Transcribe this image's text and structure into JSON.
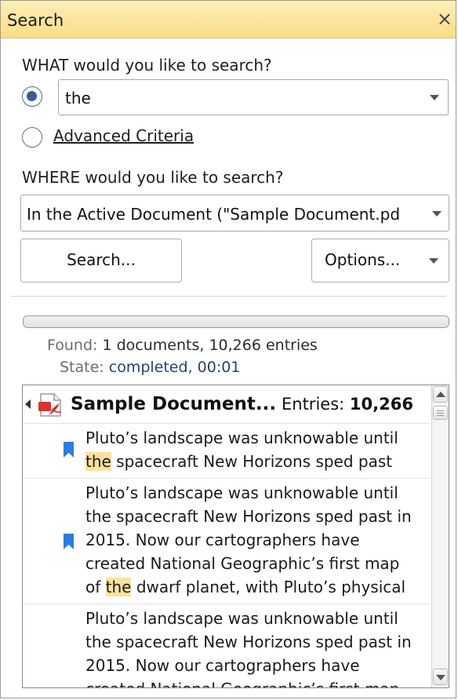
{
  "panel": {
    "title": "Search",
    "close_glyph": "×"
  },
  "what": {
    "label": "WHAT would you like to search?",
    "query_value": "the",
    "basic_selected": true,
    "advanced_label": "Advanced Criteria"
  },
  "where": {
    "label": "WHERE would you like to search?",
    "selected": "In the Active Document (\"Sample Document.pd"
  },
  "buttons": {
    "search": "Search...",
    "options": "Options..."
  },
  "status": {
    "progress": 0,
    "found_label": "Found:",
    "found_value": "1 documents, 10,266 entries",
    "state_label": "State:",
    "state_value": "completed, 00:01"
  },
  "results": {
    "document": "Sample Document...",
    "entries_label": "Entries:",
    "entries_count": "10,266",
    "items": [
      {
        "lines": [
          {
            "pre": "Pluto’s landscape was unknowable until",
            "hit": "",
            "post": ""
          },
          {
            "pre": "",
            "hit": "the",
            "post": " spacecraft New Horizons sped past"
          }
        ]
      },
      {
        "lines": [
          {
            "pre": "Pluto’s landscape was unknowable until",
            "hit": "",
            "post": ""
          },
          {
            "pre": "the spacecraft New Horizons sped past in",
            "hit": "",
            "post": ""
          },
          {
            "pre": "2015. Now our cartographers have",
            "hit": "",
            "post": ""
          },
          {
            "pre": "created National Geographic’s first map",
            "hit": "",
            "post": ""
          },
          {
            "pre": "of ",
            "hit": "the",
            "post": " dwarf planet, with Pluto’s physical"
          }
        ]
      },
      {
        "lines": [
          {
            "pre": "Pluto’s landscape was unknowable until",
            "hit": "",
            "post": ""
          },
          {
            "pre": "the spacecraft New Horizons sped past in",
            "hit": "",
            "post": ""
          },
          {
            "pre": "2015. Now our cartographers have",
            "hit": "",
            "post": ""
          },
          {
            "pre": "created National Geographic’s first map",
            "hit": "",
            "post": ""
          }
        ]
      }
    ]
  },
  "icons": {
    "close": "close-icon",
    "dropdown": "chevron-down-icon",
    "pdf": "pdf-document-icon",
    "bookmark": "bookmark-icon",
    "collapse": "expander-icon",
    "scroll_up": "arrow-up-icon",
    "scroll_down": "arrow-down-icon"
  },
  "colors": {
    "title_bar": "#f9dc86",
    "highlight": "#fbe29b",
    "bookmark": "#2b7be8",
    "pdf_red": "#d9312b",
    "radio_dot": "#3a5f96"
  }
}
